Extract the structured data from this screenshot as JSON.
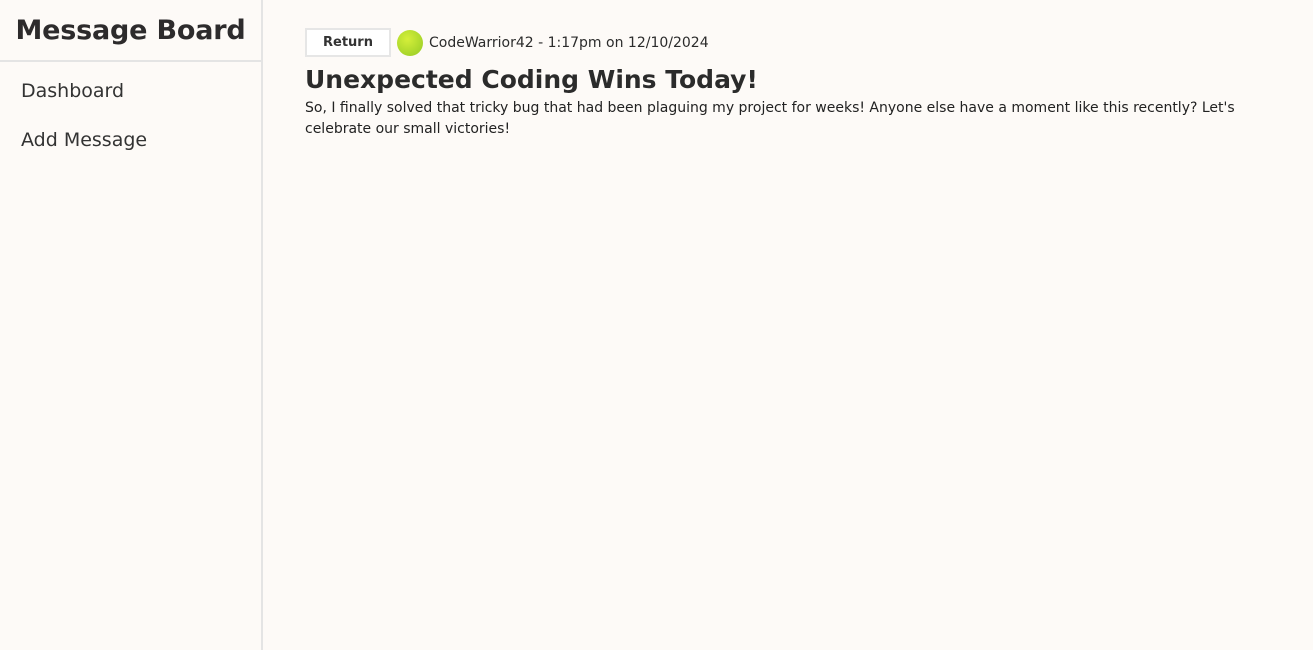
{
  "sidebar": {
    "brand": "Message Board",
    "items": [
      {
        "label": "Dashboard"
      },
      {
        "label": "Add Message"
      }
    ]
  },
  "post": {
    "return_label": "Return",
    "author": "CodeWarrior42",
    "meta": "CodeWarrior42 - 1:17pm on 12/10/2024",
    "title": "Unexpected Coding Wins Today!",
    "body": "So, I finally solved that tricky bug that had been plaguing my project for weeks! Anyone else have a moment like this recently? Let's celebrate our small victories!"
  },
  "colors": {
    "background": "#fdfaf7",
    "border": "#e4e4e4",
    "avatar": "#b5dd30",
    "text": "#2b2b2b"
  },
  "icons": {
    "avatar": "user-avatar"
  }
}
